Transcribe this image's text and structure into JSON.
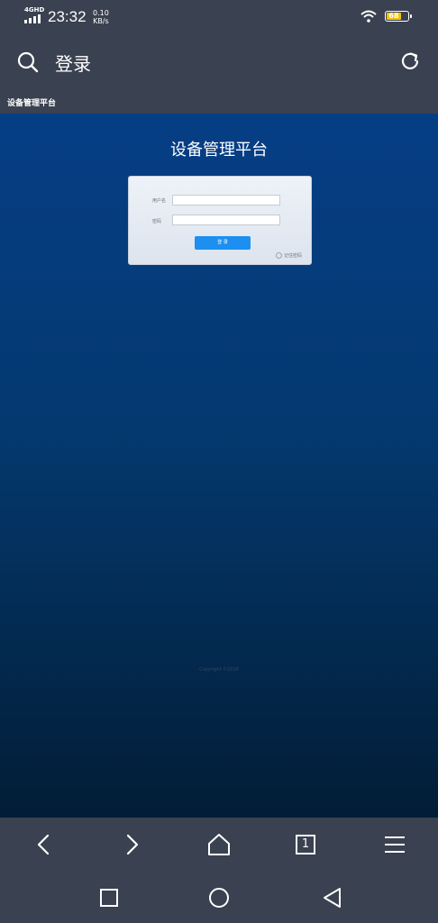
{
  "status_bar": {
    "network": "4GHD",
    "time": "23:32",
    "speed_value": "0.10",
    "speed_unit": "KB/s",
    "battery": "68"
  },
  "browser": {
    "page_heading": "登录",
    "tab_title": "设备管理平台"
  },
  "login_page": {
    "title": "设备管理平台",
    "username_label": "用户名",
    "password_label": "密码",
    "username_value": "",
    "password_value": "",
    "login_button": "登 录",
    "remember_label": "记住密码",
    "footer": "Copyright ©2018"
  },
  "bottom_nav": {
    "tab_count": "1"
  },
  "colors": {
    "chrome": "#3a4150",
    "page_top": "#063e86",
    "page_bottom": "#021d36",
    "button": "#1d8ff0",
    "battery": "#f3c20c"
  }
}
